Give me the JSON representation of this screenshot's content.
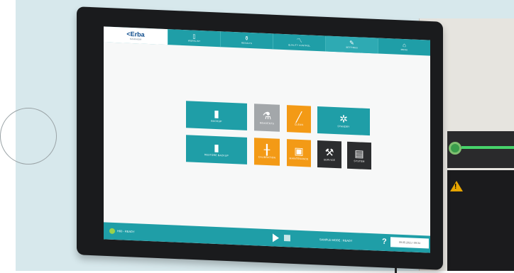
{
  "app": {
    "logo": {
      "brand": "<Erba",
      "sub": "MANNHEIM"
    },
    "tabs": [
      {
        "label": "WORKLIST",
        "icon": "clipboard-icon"
      },
      {
        "label": "RESULTS",
        "icon": "flask-icon"
      },
      {
        "label": "QUALITY CONTROL",
        "icon": "chart-icon"
      },
      {
        "label": "SETTINGS",
        "icon": "wrench-icon"
      },
      {
        "label": "MENU",
        "icon": "home-icon"
      }
    ]
  },
  "tiles": {
    "backup": {
      "label": "BACKUP",
      "icon": "bottle-icon"
    },
    "reagents": {
      "label": "REAGENTS",
      "icon": "reagents-icon"
    },
    "clean": {
      "label": "CLEAN",
      "icon": "pipette-icon"
    },
    "standby": {
      "label": "STANDBY",
      "icon": "standby-icon"
    },
    "restore_backup": {
      "label": "RESTORE BACKUP",
      "icon": "bottle-restore-icon"
    },
    "calibration": {
      "label": "CALIBRATION",
      "icon": "calibration-icon"
    },
    "maintenance": {
      "label": "MAINTENANCE",
      "icon": "container-icon"
    },
    "service": {
      "label": "SERVICE",
      "icon": "tools-icon"
    },
    "system": {
      "label": "SYSTEM",
      "icon": "system-icon"
    }
  },
  "status": {
    "state": "H60 - READY",
    "mode": "SAMPLE MODE : READY",
    "help": "?",
    "datetime": "09.05.2021 / 09:34"
  },
  "colors": {
    "teal": "#1f9ea7",
    "orange": "#f39a16",
    "gray": "#a3a7aa",
    "black": "#2c2d2f"
  }
}
